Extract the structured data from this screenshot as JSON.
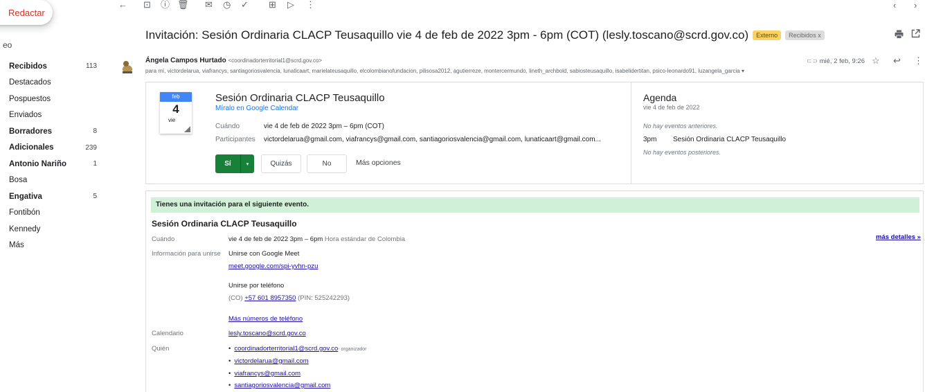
{
  "sidebar": {
    "compose": "Redactar",
    "mail_label": "eo",
    "folders": [
      {
        "name": "Recibidos",
        "count": "113",
        "bold": true
      },
      {
        "name": "Destacados",
        "count": "",
        "bold": false
      },
      {
        "name": "Pospuestos",
        "count": "",
        "bold": false
      },
      {
        "name": "Enviados",
        "count": "",
        "bold": false
      },
      {
        "name": "Borradores",
        "count": "8",
        "bold": true
      },
      {
        "name": "Adicionales",
        "count": "239",
        "bold": true
      },
      {
        "name": "Antonio Nariño",
        "count": "1",
        "bold": true
      },
      {
        "name": "Bosa",
        "count": "",
        "bold": false
      },
      {
        "name": "Engativa",
        "count": "5",
        "bold": true
      },
      {
        "name": "Fontibón",
        "count": "",
        "bold": false
      },
      {
        "name": "Kennedy",
        "count": "",
        "bold": false
      },
      {
        "name": "Más",
        "count": "",
        "bold": false
      }
    ]
  },
  "toolbar": {
    "back_icon": "←",
    "archive_icon": "⊡",
    "spam_icon": "ⓘ",
    "delete_icon": "🗑",
    "unread_icon": "✉",
    "snooze_icon": "◷",
    "task_icon": "✓",
    "move_icon": "⊞",
    "label_icon": "▷",
    "more_icon": "⋮",
    "prev_icon": "‹",
    "next_icon": "›"
  },
  "email": {
    "subject": "Invitación: Sesión Ordinaria CLACP Teusaquillo vie 4 de feb de 2022 3pm - 6pm (COT) (lesly.toscano@scrd.gov.co)",
    "badge_external": "Externo",
    "badge_inbox": "Recibidos x",
    "sender_name": "Ángela Campos Hurtado",
    "sender_email": "<coordinadorterritorial1@scrd.gov.co>",
    "recipients": "para mí, victordelarua, viafrancys, santiagoriosvalencia, lunaticaart, marielateusaquillo, elcolombianofundacion, pilisosa2012, agutierreze, montercermundo, lineth_archbold, sabiosteusaquillo, isabelidertitan, psico-leonardo91, luzangela_garcia ▾",
    "date": "mié, 2 feb, 9:26"
  },
  "invite": {
    "month": "feb",
    "day": "4",
    "dow": "vie",
    "title": "Sesión Ordinaria CLACP Teusaquillo",
    "gcal_link": "Míralo en Google Calendar",
    "when_label": "Cuándo",
    "when_value": "vie 4 de feb de 2022 3pm – 6pm (COT)",
    "participants_label": "Participantes",
    "participants_value": "victordelarua@gmail.com, viafrancys@gmail.com, santiagoriosvalencia@gmail.com, lunaticaart@gmail.com...",
    "yes": "Sí",
    "dropdown": "▾",
    "maybe": "Quizás",
    "no": "No",
    "more_options": "Más opciones",
    "agenda_title": "Agenda",
    "agenda_date": "vie 4 de feb de 2022",
    "agenda_no_prev": "No hay eventos anteriores.",
    "agenda_time": "3pm",
    "agenda_event": "Sesión Ordinaria CLACP Teusaquillo",
    "agenda_no_next": "No hay eventos posteriores."
  },
  "details": {
    "banner": "Tienes una invitación para el siguiente evento.",
    "title": "Sesión Ordinaria CLACP Teusaquillo",
    "when_label": "Cuándo",
    "when_value": "vie 4 de feb de 2022 3pm – 6pm",
    "when_tz": "Hora estándar de Colombia",
    "more_details": "más detalles »",
    "join_label": "Información para unirse",
    "join_meet": "Unirse con Google Meet",
    "meet_link": "meet.google.com/spi-yvhn-pzu",
    "join_phone": "Unirse por teléfono",
    "phone_prefix": "(CO)",
    "phone_number": "+57 601 8957350",
    "phone_pin": "(PIN: 525242293)",
    "more_numbers": "Más números de teléfono",
    "calendar_label": "Calendario",
    "calendar_value": "lesly.toscano@scrd.gov.co",
    "who_label": "Quién",
    "organizer_suffix": "- organizador",
    "who": [
      "coordinadorterritorial1@scrd.gov.co",
      "victordelarua@gmail.com",
      "viafrancys@gmail.com",
      "santiagoriosvalencia@gmail.com"
    ]
  },
  "colors": {
    "accept_green": "#188038",
    "banner_green": "#d0f0d8",
    "calendar_blue": "#4285f4",
    "external_badge": "#fad165"
  }
}
